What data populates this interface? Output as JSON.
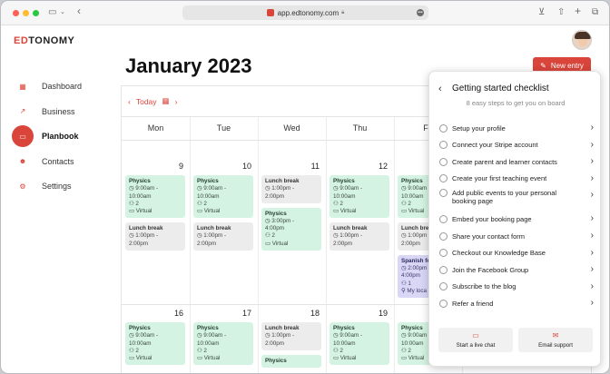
{
  "browser": {
    "url": "app.edtonomy.com"
  },
  "brand": {
    "prefix": "ED",
    "suffix": "TONOMY",
    "accent": "#d9453b"
  },
  "sidebar": {
    "items": [
      {
        "label": "Dashboard",
        "icon": "grid-icon",
        "glyph": "▦",
        "active": false
      },
      {
        "label": "Business",
        "icon": "trending-icon",
        "glyph": "↗",
        "active": false
      },
      {
        "label": "Planbook",
        "icon": "book-icon",
        "glyph": "▭",
        "active": true
      },
      {
        "label": "Contacts",
        "icon": "people-icon",
        "glyph": "☻",
        "active": false
      },
      {
        "label": "Settings",
        "icon": "gear-icon",
        "glyph": "⚙",
        "active": false
      }
    ]
  },
  "page": {
    "title": "January 2023",
    "new_entry": "New entry"
  },
  "calendar": {
    "today_label": "Today",
    "days": [
      "Mon",
      "Tue",
      "Wed",
      "Thu",
      "Fri"
    ],
    "weeks": [
      {
        "dates": [
          "9",
          "10",
          "11",
          "12",
          ""
        ],
        "events": [
          [
            {
              "kind": "green",
              "title": "Physics",
              "lines": [
                "◷ 9:00am -",
                "10:00am",
                "⚇ 2",
                "▭ Virtual"
              ]
            },
            {
              "kind": "gray",
              "title": "Lunch break",
              "lines": [
                "◷ 1:00pm -",
                "2:00pm"
              ]
            }
          ],
          [
            {
              "kind": "green",
              "title": "Physics",
              "lines": [
                "◷ 9:00am -",
                "10:00am",
                "⚇ 2",
                "▭ Virtual"
              ]
            },
            {
              "kind": "gray",
              "title": "Lunch break",
              "lines": [
                "◷ 1:00pm -",
                "2:00pm"
              ]
            }
          ],
          [
            {
              "kind": "gray",
              "title": "Lunch break",
              "lines": [
                "◷ 1:00pm -",
                "2:00pm"
              ]
            },
            {
              "kind": "green",
              "title": "Physics",
              "lines": [
                "◷ 3:00pm -",
                "4:00pm",
                "⚇ 2",
                "▭ Virtual"
              ]
            }
          ],
          [
            {
              "kind": "green",
              "title": "Physics",
              "lines": [
                "◷ 9:00am -",
                "10:00am",
                "⚇ 2",
                "▭ Virtual"
              ]
            },
            {
              "kind": "gray",
              "title": "Lunch break",
              "lines": [
                "◷ 1:00pm -",
                "2:00pm"
              ]
            }
          ],
          [
            {
              "kind": "green",
              "title": "Physics",
              "lines": [
                "◷ 9:00am -",
                "10:00am",
                "⚇ 2",
                "▭ Virtual"
              ]
            },
            {
              "kind": "gray",
              "title": "Lunch break",
              "lines": [
                "◷ 1:00pm -",
                "2:00pm"
              ]
            },
            {
              "kind": "purple",
              "title": "Spanish fo",
              "lines": [
                "◷ 2:00pm",
                "4:00pm",
                "⚇ 1",
                "⚲ My loca"
              ]
            }
          ]
        ]
      },
      {
        "dates": [
          "16",
          "17",
          "18",
          "19",
          ""
        ],
        "events": [
          [
            {
              "kind": "green",
              "title": "Physics",
              "lines": [
                "◷ 9:00am -",
                "10:00am",
                "⚇ 2",
                "▭ Virtual"
              ]
            }
          ],
          [
            {
              "kind": "green",
              "title": "Physics",
              "lines": [
                "◷ 9:00am -",
                "10:00am",
                "⚇ 2",
                "▭ Virtual"
              ]
            }
          ],
          [
            {
              "kind": "gray",
              "title": "Lunch break",
              "lines": [
                "◷ 1:00pm -",
                "2:00pm"
              ]
            },
            {
              "kind": "green",
              "title": "Physics",
              "lines": []
            }
          ],
          [
            {
              "kind": "green",
              "title": "Physics",
              "lines": [
                "◷ 9:00am -",
                "10:00am",
                "⚇ 2",
                "▭ Virtual"
              ]
            }
          ],
          [
            {
              "kind": "green",
              "title": "Physics",
              "lines": [
                "◷ 9:00am -",
                "10:00am",
                "⚇ 2",
                "▭ Virtual"
              ]
            }
          ]
        ]
      }
    ]
  },
  "checklist": {
    "title": "Getting started checklist",
    "subtitle": "8 easy steps to get you on board",
    "items": [
      [
        "Setup your profile"
      ],
      [
        "Connect your Stripe account"
      ],
      [
        "Create parent and learner contacts"
      ],
      [
        "Create your first teaching event"
      ],
      [
        "Add public events to your personal",
        "booking page"
      ],
      [
        "Embed your booking page"
      ],
      [
        "Share your contact form"
      ],
      [
        "Checkout our Knowledge Base"
      ],
      [
        "Join the Facebook Group"
      ],
      [
        "Subscribe to the blog"
      ],
      [
        "Refer a friend"
      ]
    ],
    "live_chat": "Start a live chat",
    "email_support": "Email support"
  }
}
